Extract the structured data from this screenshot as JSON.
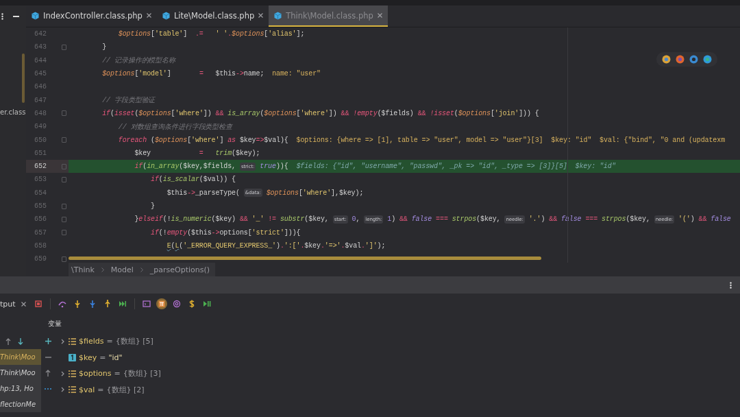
{
  "project_panel": {
    "file_label": "er.class"
  },
  "tabs": [
    {
      "label": "IndexController.class.php",
      "selected": false
    },
    {
      "label": "Lite\\Model.class.php",
      "selected": false
    },
    {
      "label": "Think\\Model.class.php",
      "selected": true
    }
  ],
  "editor": {
    "lines": [
      {
        "number": "642",
        "current": false,
        "fold": false,
        "tokens": [
          {
            "kind": "v",
            "text": "            $options"
          },
          {
            "kind": "p",
            "text": "["
          },
          {
            "kind": "s",
            "text": "'table'"
          },
          {
            "kind": "p",
            "text": "]  "
          },
          {
            "kind": "o",
            "text": ".=   "
          },
          {
            "kind": "s",
            "text": "' '"
          },
          {
            "kind": "o",
            "text": "."
          },
          {
            "kind": "v",
            "text": "$options"
          },
          {
            "kind": "p",
            "text": "["
          },
          {
            "kind": "s",
            "text": "'alias'"
          },
          {
            "kind": "p",
            "text": "];"
          }
        ]
      },
      {
        "number": "643",
        "current": false,
        "fold": true,
        "tokens": [
          {
            "kind": "p",
            "text": "        }"
          }
        ]
      },
      {
        "number": "644",
        "current": false,
        "fold": false,
        "tokens": [
          {
            "kind": "c",
            "text": "        // 记录操作的模型名称"
          }
        ]
      },
      {
        "number": "645",
        "current": false,
        "fold": false,
        "tokens": [
          {
            "kind": "v",
            "text": "        $options"
          },
          {
            "kind": "p",
            "text": "["
          },
          {
            "kind": "s",
            "text": "'model'"
          },
          {
            "kind": "p",
            "text": "]       "
          },
          {
            "kind": "o",
            "text": "=   "
          },
          {
            "kind": "p",
            "text": "$this"
          },
          {
            "kind": "o",
            "text": "->"
          },
          {
            "kind": "p",
            "text": "name;  "
          },
          {
            "kind": "d",
            "text": "name: \"user\""
          }
        ]
      },
      {
        "number": "646",
        "current": false,
        "fold": false
      },
      {
        "number": "647",
        "current": false,
        "fold": false,
        "tokens": [
          {
            "kind": "c",
            "text": "        // 字段类型验证"
          }
        ]
      },
      {
        "number": "648",
        "current": false,
        "fold": true,
        "tokens": [
          {
            "kind": "k",
            "text": "        if"
          },
          {
            "kind": "p",
            "text": "("
          },
          {
            "kind": "k",
            "text": "isset"
          },
          {
            "kind": "p",
            "text": "("
          },
          {
            "kind": "v",
            "text": "$options"
          },
          {
            "kind": "p",
            "text": "["
          },
          {
            "kind": "s",
            "text": "'where'"
          },
          {
            "kind": "p",
            "text": "]) "
          },
          {
            "kind": "o",
            "text": "&& "
          },
          {
            "kind": "f",
            "text": "is_array"
          },
          {
            "kind": "p",
            "text": "("
          },
          {
            "kind": "v",
            "text": "$options"
          },
          {
            "kind": "p",
            "text": "["
          },
          {
            "kind": "s",
            "text": "'where'"
          },
          {
            "kind": "p",
            "text": "]) "
          },
          {
            "kind": "o",
            "text": "&& "
          },
          {
            "kind": "k",
            "text": "!empty"
          },
          {
            "kind": "p",
            "text": "($fields) "
          },
          {
            "kind": "o",
            "text": "&& "
          },
          {
            "kind": "k",
            "text": "!isset"
          },
          {
            "kind": "p",
            "text": "("
          },
          {
            "kind": "v",
            "text": "$options"
          },
          {
            "kind": "p",
            "text": "["
          },
          {
            "kind": "s",
            "text": "'join'"
          },
          {
            "kind": "p",
            "text": "])) {"
          }
        ]
      },
      {
        "number": "649",
        "current": false,
        "fold": false,
        "tokens": [
          {
            "kind": "c",
            "text": "            // 对数组查询条件进行字段类型检查"
          }
        ]
      },
      {
        "number": "650",
        "current": false,
        "fold": true,
        "tokens": [
          {
            "kind": "k",
            "text": "            foreach "
          },
          {
            "kind": "p",
            "text": "("
          },
          {
            "kind": "v",
            "text": "$options"
          },
          {
            "kind": "p",
            "text": "["
          },
          {
            "kind": "s",
            "text": "'where'"
          },
          {
            "kind": "p",
            "text": "] "
          },
          {
            "kind": "k",
            "text": "as "
          },
          {
            "kind": "p",
            "text": "$key"
          },
          {
            "kind": "o",
            "text": "=>"
          },
          {
            "kind": "p",
            "text": "$val){  "
          },
          {
            "kind": "d",
            "text": "$options: {where => [1], table => \"user\", model => \"user\"}[3]  $key: \"id\"  $val: {\"bind\", \"0 and (updatexm"
          }
        ]
      },
      {
        "number": "651",
        "current": false,
        "fold": false,
        "tokens": [
          {
            "kind": "p",
            "text": "                $key            "
          },
          {
            "kind": "o",
            "text": "=   "
          },
          {
            "kind": "f",
            "text": "trim"
          },
          {
            "kind": "p",
            "text": "($key);"
          }
        ]
      },
      {
        "number": "652",
        "current": true,
        "fold": true,
        "tokens": [
          {
            "kind": "k",
            "text": "                if"
          },
          {
            "kind": "p",
            "text": "("
          },
          {
            "kind": "f",
            "text": "in_array"
          },
          {
            "kind": "p",
            "text": "($key,$fields, "
          },
          {
            "kind": "h",
            "text": "strict:"
          },
          {
            "kind": "b",
            "text": " true"
          },
          {
            "kind": "p",
            "text": ")){  "
          },
          {
            "kind": "t",
            "text": "$fields: {\"id\", \"username\", \"passwd\", _pk => \"id\", _type => [3]}[5]  $key: \"id\""
          }
        ]
      },
      {
        "number": "653",
        "current": false,
        "fold": true,
        "tokens": [
          {
            "kind": "k",
            "text": "                    if"
          },
          {
            "kind": "p",
            "text": "("
          },
          {
            "kind": "f",
            "text": "is_scalar"
          },
          {
            "kind": "p",
            "text": "($val)) {"
          }
        ]
      },
      {
        "number": "654",
        "current": false,
        "fold": false,
        "tokens": [
          {
            "kind": "p",
            "text": "                        $this"
          },
          {
            "kind": "o",
            "text": "->"
          },
          {
            "kind": "p",
            "text": "_parseType( "
          },
          {
            "kind": "h",
            "text": "&data:"
          },
          {
            "kind": "v",
            "text": " $options"
          },
          {
            "kind": "p",
            "text": "["
          },
          {
            "kind": "s",
            "text": "'where'"
          },
          {
            "kind": "p",
            "text": "],$key);"
          }
        ]
      },
      {
        "number": "655",
        "current": false,
        "fold": true,
        "tokens": [
          {
            "kind": "p",
            "text": "                    }"
          }
        ]
      },
      {
        "number": "656",
        "current": false,
        "fold": true,
        "tokens": [
          {
            "kind": "p",
            "text": "                }"
          },
          {
            "kind": "k",
            "text": "elseif"
          },
          {
            "kind": "p",
            "text": "(!"
          },
          {
            "kind": "f",
            "text": "is_numeric"
          },
          {
            "kind": "p",
            "text": "($key) "
          },
          {
            "kind": "o",
            "text": "&& "
          },
          {
            "kind": "s",
            "text": "'_' "
          },
          {
            "kind": "o",
            "text": "!= "
          },
          {
            "kind": "f",
            "text": "substr"
          },
          {
            "kind": "p",
            "text": "($key, "
          },
          {
            "kind": "h",
            "text": "start:"
          },
          {
            "kind": "n",
            "text": " 0"
          },
          {
            "kind": "p",
            "text": ", "
          },
          {
            "kind": "h",
            "text": "length:"
          },
          {
            "kind": "n",
            "text": " 1"
          },
          {
            "kind": "p",
            "text": ") "
          },
          {
            "kind": "o",
            "text": "&& "
          },
          {
            "kind": "b",
            "text": "false "
          },
          {
            "kind": "o",
            "text": "=== "
          },
          {
            "kind": "f",
            "text": "strpos"
          },
          {
            "kind": "p",
            "text": "($key, "
          },
          {
            "kind": "h",
            "text": "needle:"
          },
          {
            "kind": "s",
            "text": " '.'"
          },
          {
            "kind": "p",
            "text": ") "
          },
          {
            "kind": "o",
            "text": "&& "
          },
          {
            "kind": "b",
            "text": "false "
          },
          {
            "kind": "o",
            "text": "=== "
          },
          {
            "kind": "f",
            "text": "strpos"
          },
          {
            "kind": "p",
            "text": "($key, "
          },
          {
            "kind": "h",
            "text": "needle:"
          },
          {
            "kind": "s",
            "text": " '('"
          },
          {
            "kind": "p",
            "text": ") "
          },
          {
            "kind": "o",
            "text": "&& "
          },
          {
            "kind": "b",
            "text": "false"
          }
        ]
      },
      {
        "number": "657",
        "current": false,
        "fold": true,
        "tokens": [
          {
            "kind": "k",
            "text": "                    if"
          },
          {
            "kind": "p",
            "text": "(!"
          },
          {
            "kind": "k",
            "text": "empty"
          },
          {
            "kind": "p",
            "text": "($this"
          },
          {
            "kind": "o",
            "text": "->"
          },
          {
            "kind": "p",
            "text": "options["
          },
          {
            "kind": "s",
            "text": "'strict'"
          },
          {
            "kind": "p",
            "text": "])){"
          }
        ]
      },
      {
        "number": "658",
        "current": false,
        "fold": false,
        "tokens": [
          {
            "kind": "y",
            "text": "                        E"
          },
          {
            "kind": "p",
            "text": "("
          },
          {
            "kind": "y",
            "text": "L"
          },
          {
            "kind": "p",
            "text": "("
          },
          {
            "kind": "s",
            "text": "'_ERROR_QUERY_EXPRESS_'"
          },
          {
            "kind": "p",
            "text": ")"
          },
          {
            "kind": "o",
            "text": "."
          },
          {
            "kind": "s",
            "text": "':['"
          },
          {
            "kind": "o",
            "text": "."
          },
          {
            "kind": "p",
            "text": "$key"
          },
          {
            "kind": "o",
            "text": "."
          },
          {
            "kind": "s",
            "text": "'=>'"
          },
          {
            "kind": "o",
            "text": "."
          },
          {
            "kind": "p",
            "text": "$val"
          },
          {
            "kind": "o",
            "text": "."
          },
          {
            "kind": "s",
            "text": "']'"
          },
          {
            "kind": "p",
            "text": ");"
          }
        ]
      },
      {
        "number": "659",
        "current": false,
        "fold": true
      }
    ]
  },
  "breadcrumb": [
    "\\Think",
    "Model",
    "_parseOptions()"
  ],
  "debug": {
    "tab_label": "tput",
    "variables_title": "变量",
    "frames": [
      {
        "label": "Think\\Moo",
        "selected": true
      },
      {
        "label": "Think\\Moo",
        "selected": false
      },
      {
        "label": "hp:13, Ho",
        "selected": false
      },
      {
        "label": "flectionMe",
        "selected": false
      }
    ],
    "variables": [
      {
        "kind": "array",
        "name": "$fields",
        "operator": "=",
        "value": "{数组} [5]"
      },
      {
        "kind": "scalar",
        "name": "$key",
        "operator": "=",
        "value": "\"id\""
      },
      {
        "kind": "array",
        "name": "$options",
        "operator": "=",
        "value": "{数组} [3]"
      },
      {
        "kind": "array",
        "name": "$val",
        "operator": "=",
        "value": "{数组} [2]"
      }
    ]
  }
}
